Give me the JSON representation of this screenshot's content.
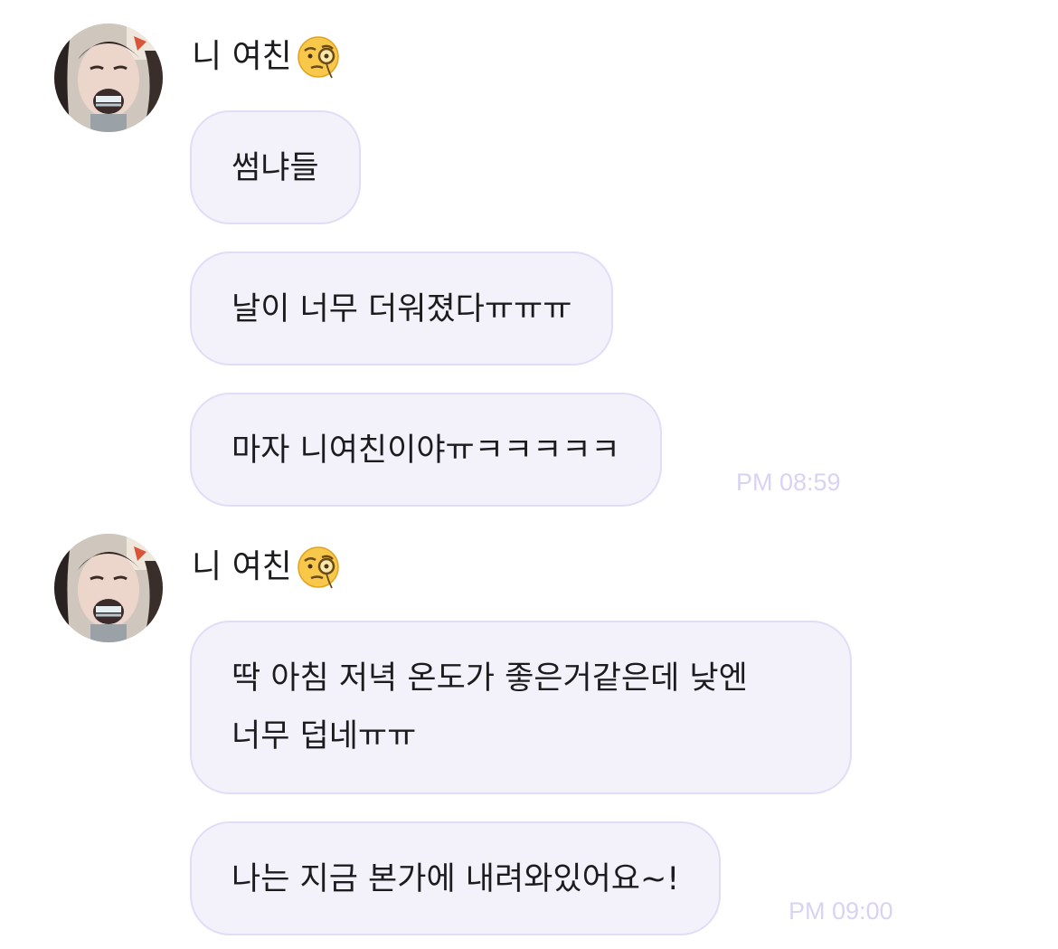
{
  "groups": [
    {
      "sender": "니 여친",
      "sender_emoji": "face-with-monocle-icon",
      "messages": [
        "썸냐들",
        "날이 너무 더워졌다ㅠㅠㅠ",
        "마자 니여친이야ㅠㅋㅋㅋㅋㅋ"
      ],
      "time": "PM 08:59"
    },
    {
      "sender": "니 여친",
      "sender_emoji": "face-with-monocle-icon",
      "messages": [
        "딱 아침 저녁 온도가 좋은거같은데 낮엔\n너무 덥네ㅠㅠ",
        "나는 지금 본가에 내려와있어요~!"
      ],
      "time": "PM 09:00"
    }
  ],
  "colors": {
    "bubble_bg": "#f3f2fb",
    "bubble_border": "#e2dcf6",
    "time_text": "#d9d2f3"
  }
}
